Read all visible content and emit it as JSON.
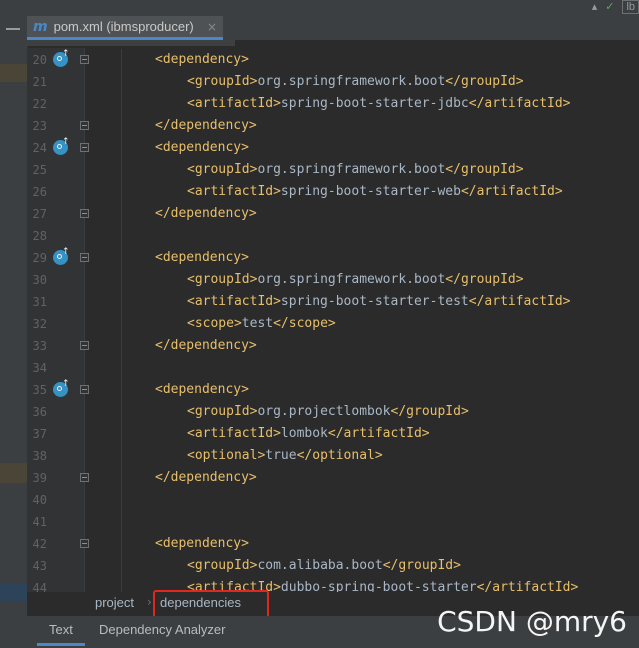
{
  "editor_tab": {
    "title": "pom.xml (ibmsproducer)",
    "close": "×",
    "icon": "m"
  },
  "top_right": {
    "label": "lb"
  },
  "lines": [
    {
      "n": "20",
      "indent": 1,
      "marker": true,
      "fold": true,
      "parts": [
        [
          "tag",
          "<dependency>"
        ]
      ]
    },
    {
      "n": "21",
      "indent": 2,
      "marker": false,
      "fold": false,
      "parts": [
        [
          "tag",
          "<groupId>"
        ],
        [
          "txt",
          "org.springframework.boot"
        ],
        [
          "tag",
          "</groupId>"
        ]
      ]
    },
    {
      "n": "22",
      "indent": 2,
      "marker": false,
      "fold": false,
      "parts": [
        [
          "tag",
          "<artifactId>"
        ],
        [
          "txt",
          "spring-boot-starter-jdbc"
        ],
        [
          "tag",
          "</artifactId>"
        ]
      ]
    },
    {
      "n": "23",
      "indent": 1,
      "marker": false,
      "fold": true,
      "parts": [
        [
          "tag",
          "</dependency>"
        ]
      ]
    },
    {
      "n": "24",
      "indent": 1,
      "marker": true,
      "fold": true,
      "parts": [
        [
          "tag",
          "<dependency>"
        ]
      ]
    },
    {
      "n": "25",
      "indent": 2,
      "marker": false,
      "fold": false,
      "parts": [
        [
          "tag",
          "<groupId>"
        ],
        [
          "txt",
          "org.springframework.boot"
        ],
        [
          "tag",
          "</groupId>"
        ]
      ]
    },
    {
      "n": "26",
      "indent": 2,
      "marker": false,
      "fold": false,
      "parts": [
        [
          "tag",
          "<artifactId>"
        ],
        [
          "txt",
          "spring-boot-starter-web"
        ],
        [
          "tag",
          "</artifactId>"
        ]
      ]
    },
    {
      "n": "27",
      "indent": 1,
      "marker": false,
      "fold": true,
      "parts": [
        [
          "tag",
          "</dependency>"
        ]
      ]
    },
    {
      "n": "28",
      "indent": 0,
      "marker": false,
      "fold": false,
      "parts": []
    },
    {
      "n": "29",
      "indent": 1,
      "marker": true,
      "fold": true,
      "parts": [
        [
          "tag",
          "<dependency>"
        ]
      ]
    },
    {
      "n": "30",
      "indent": 2,
      "marker": false,
      "fold": false,
      "parts": [
        [
          "tag",
          "<groupId>"
        ],
        [
          "txt",
          "org.springframework.boot"
        ],
        [
          "tag",
          "</groupId>"
        ]
      ]
    },
    {
      "n": "31",
      "indent": 2,
      "marker": false,
      "fold": false,
      "parts": [
        [
          "tag",
          "<artifactId>"
        ],
        [
          "txt",
          "spring-boot-starter-test"
        ],
        [
          "tag",
          "</artifactId>"
        ]
      ]
    },
    {
      "n": "32",
      "indent": 2,
      "marker": false,
      "fold": false,
      "parts": [
        [
          "tag",
          "<scope>"
        ],
        [
          "txt",
          "test"
        ],
        [
          "tag",
          "</scope>"
        ]
      ]
    },
    {
      "n": "33",
      "indent": 1,
      "marker": false,
      "fold": true,
      "parts": [
        [
          "tag",
          "</dependency>"
        ]
      ]
    },
    {
      "n": "34",
      "indent": 0,
      "marker": false,
      "fold": false,
      "parts": []
    },
    {
      "n": "35",
      "indent": 1,
      "marker": true,
      "fold": true,
      "parts": [
        [
          "tag",
          "<dependency>"
        ]
      ]
    },
    {
      "n": "36",
      "indent": 2,
      "marker": false,
      "fold": false,
      "parts": [
        [
          "tag",
          "<groupId>"
        ],
        [
          "txt",
          "org.projectlombok"
        ],
        [
          "tag",
          "</groupId>"
        ]
      ]
    },
    {
      "n": "37",
      "indent": 2,
      "marker": false,
      "fold": false,
      "parts": [
        [
          "tag",
          "<artifactId>"
        ],
        [
          "txt",
          "lombok"
        ],
        [
          "tag",
          "</artifactId>"
        ]
      ]
    },
    {
      "n": "38",
      "indent": 2,
      "marker": false,
      "fold": false,
      "parts": [
        [
          "tag",
          "<optional>"
        ],
        [
          "txt",
          "true"
        ],
        [
          "tag",
          "</optional>"
        ]
      ]
    },
    {
      "n": "39",
      "indent": 1,
      "marker": false,
      "fold": true,
      "parts": [
        [
          "tag",
          "</dependency>"
        ]
      ]
    },
    {
      "n": "40",
      "indent": 0,
      "marker": false,
      "fold": false,
      "parts": []
    },
    {
      "n": "41",
      "indent": 0,
      "marker": false,
      "fold": false,
      "parts": []
    },
    {
      "n": "42",
      "indent": 1,
      "marker": false,
      "fold": true,
      "parts": [
        [
          "tag",
          "<dependency>"
        ]
      ]
    },
    {
      "n": "43",
      "indent": 2,
      "marker": false,
      "fold": false,
      "parts": [
        [
          "tag",
          "<groupId>"
        ],
        [
          "txt",
          "com.alibaba.boot"
        ],
        [
          "tag",
          "</groupId>"
        ]
      ]
    },
    {
      "n": "44",
      "indent": 2,
      "marker": false,
      "fold": false,
      "parts": [
        [
          "tag",
          "<artifactId>"
        ],
        [
          "txt",
          "dubbo-spring-boot-starter"
        ],
        [
          "tag",
          "</artifactId>"
        ]
      ]
    }
  ],
  "breadcrumbs": {
    "item1": "project",
    "separator": "›",
    "item2": "dependencies"
  },
  "bottom_tabs": {
    "text": "Text",
    "analyzer": "Dependency Analyzer"
  },
  "watermark": "CSDN @mry6",
  "colors": {
    "tag": "#e8bf6a",
    "text": "#a9b7c6",
    "highlight_box": "#e0281e",
    "accent": "#4a88c7"
  },
  "icons": {
    "maven_module_marker": "maven-override-icon",
    "fold_marker": "fold-icon",
    "close": "close-icon"
  }
}
